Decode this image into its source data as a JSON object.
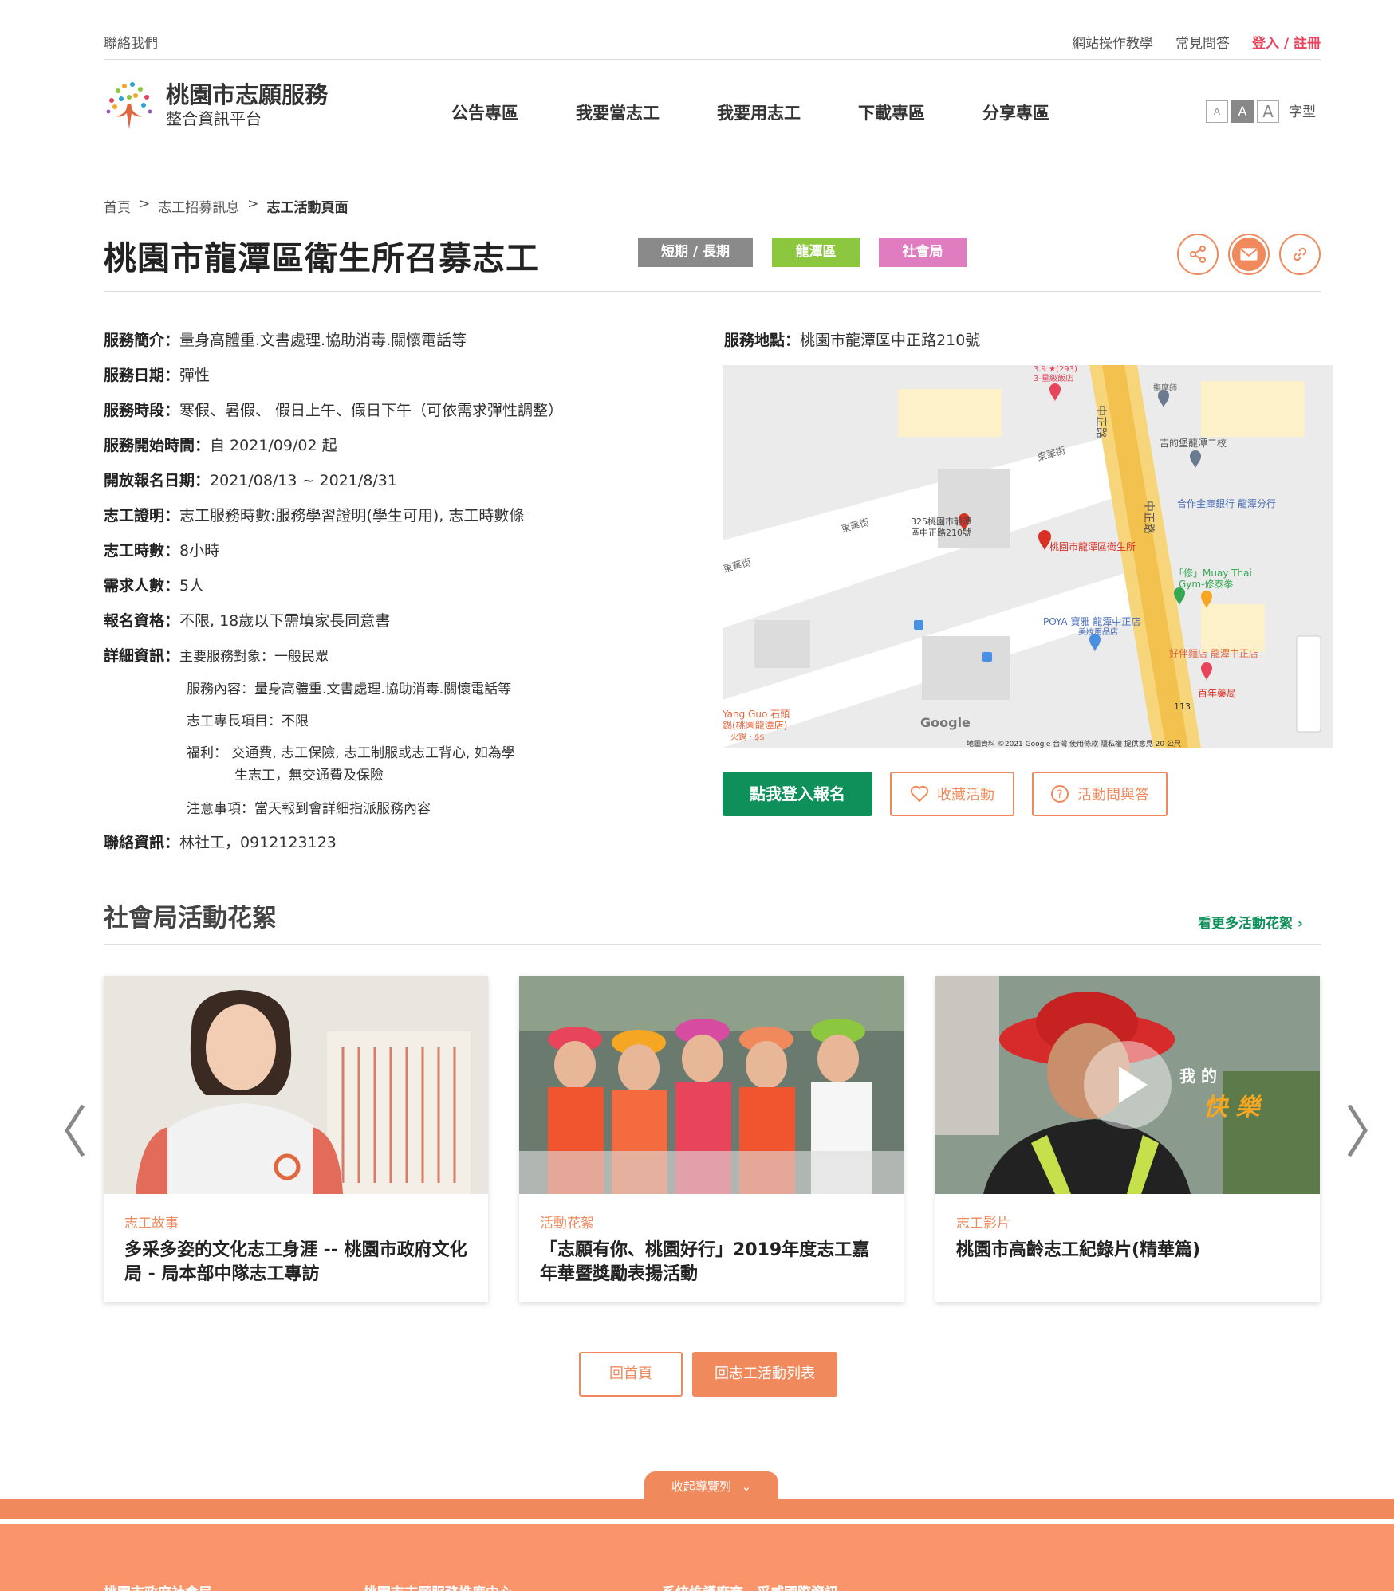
{
  "topbar": {
    "contact": "聯絡我們",
    "tutorial": "網站操作教學",
    "faq": "常見問答",
    "login": "登入 / 註冊"
  },
  "logo": {
    "line1": "桃園市志願服務",
    "line2": "整合資訊平台"
  },
  "nav": [
    "公告專區",
    "我要當志工",
    "我要用志工",
    "下載專區",
    "分享專區"
  ],
  "font_size": {
    "small": "A",
    "medium": "A",
    "large": "A",
    "label": "字型"
  },
  "breadcrumb": {
    "home": "首頁",
    "sep": ">",
    "level1": "志工招募訊息",
    "current": "志工活動頁面"
  },
  "page_title": "桃園市龍潭區衛生所召募志工",
  "tags": [
    {
      "label": "短期 / 長期",
      "color": "#8a8a8a"
    },
    {
      "label": "龍潭區",
      "color": "#8dc63f"
    },
    {
      "label": "社會局",
      "color": "#e07cc0"
    }
  ],
  "share_icons": [
    "share-icon",
    "mail-icon",
    "link-icon"
  ],
  "details": [
    {
      "label": "服務簡介：",
      "value": "量身高體重.文書處理.協助消毒.關懷電話等"
    },
    {
      "label": "服務日期：",
      "value": "彈性"
    },
    {
      "label": "服務時段：",
      "value": "寒假、暑假、 假日上午、假日下午（可依需求彈性調整）"
    },
    {
      "label": "服務開始時間：",
      "value": "自 2021/09/02 起"
    },
    {
      "label": "開放報名日期：",
      "value": "2021/08/13 ~ 2021/8/31"
    },
    {
      "label": "志工證明：",
      "value": "志工服務時數:服務學習證明(學生可用), 志工時數條"
    },
    {
      "label": "志工時數：",
      "value": "8小時"
    },
    {
      "label": "需求人數：",
      "value": "5人"
    },
    {
      "label": "報名資格：",
      "value": "不限, 18歲以下需填家長同意書"
    },
    {
      "label": "詳細資訊：",
      "value": "主要服務對象：一般民眾"
    }
  ],
  "detail_sub": [
    "服務內容：量身高體重.文書處理.協助消毒.關懷電話等",
    "志工專長項目：不限",
    "福利：  交通費, 志工保險, 志工制服或志工背心, 如為學",
    "生志工，無交通費及保險",
    "注意事項：當天報到會詳細指派服務內容"
  ],
  "contact": {
    "label": "聯絡資訊：",
    "value": "林社工，0912123123"
  },
  "location": {
    "label": "服務地點：",
    "value": "桃園市龍潭區中正路210號"
  },
  "map": {
    "labels": [
      "中正路",
      "東華街",
      "東華街",
      "東華街",
      "中正路",
      "吉的堡龍潭二校",
      "合作金庫銀行 龍潭分行",
      "325桃園市龍潭",
      "區中正路210號",
      "桃園市龍潭區衛生所",
      "「修」Muay Thai",
      "Gym-修泰拳",
      "POYA 寶雅 龍潭中正店",
      "美妝用品店",
      "好伴麵店 龍潭中正店",
      "百年藥局",
      "113",
      "Yang Guo 石頭",
      "鍋(桃園龍潭店)",
      "火鍋・$$",
      "Google",
      "地圖資料 ©2021 Google   台灣   使用條款   隱私權   提供意見   20 公尺",
      "3.9 ★(293)",
      "3-星級飯店",
      "撫摩師"
    ]
  },
  "actions": {
    "signup": "點我登入報名",
    "favorite": "收藏活動",
    "qa": "活動問與答"
  },
  "gallery": {
    "title": "社會局活動花絮",
    "more": "看更多活動花絮 ›",
    "cards": [
      {
        "category": "志工故事",
        "title": "多采多姿的文化志工身涯 -- 桃園市政府文化局 - 局本部中隊志工專訪"
      },
      {
        "category": "活動花絮",
        "title": "「志願有你、桃園好行」2019年度志工嘉年華暨獎勵表揚活動"
      },
      {
        "category": "志工影片",
        "title": "桃園市高齡志工紀錄片(精華篇)",
        "overlay1": "我 的",
        "overlay2": "快 樂"
      }
    ],
    "prev": "〈",
    "next": "〉"
  },
  "bottom_buttons": {
    "home": "回首頁",
    "list": "回志工活動列表"
  },
  "footer": {
    "toggle": "收起導覽列",
    "cols": [
      "桃園市政府社會局",
      "桃園市志願服務推廣中心",
      "系統維護廠商－采威國際資訊"
    ]
  },
  "colors": {
    "accent": "#f08a5d",
    "green": "#0f8f5a",
    "login": "#e8455c"
  }
}
